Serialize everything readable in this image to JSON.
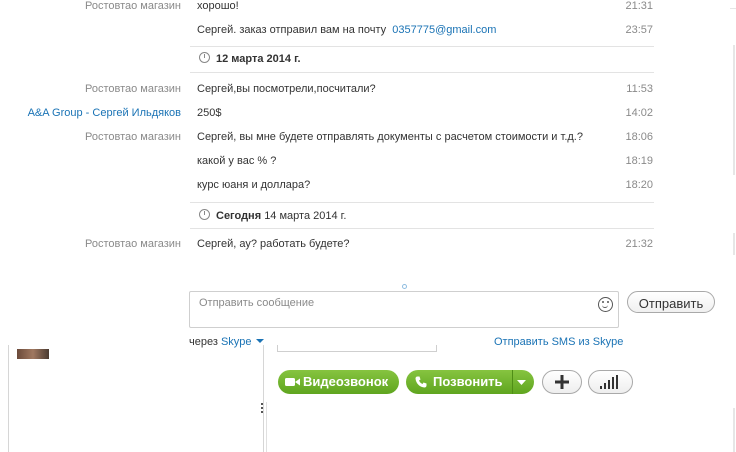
{
  "chat": {
    "entries": [
      {
        "sender": "Ростовтао магазин",
        "text": "хорошо!",
        "time": "21:31"
      },
      {
        "sender": "",
        "text": "Сергей. заказ отправил вам на почту",
        "link": "0357775@gmail.com",
        "time": "23:57"
      },
      {
        "sender": "Ростовтао магазин",
        "text": "Сергей,вы посмотрели,посчитали?",
        "time": "11:53"
      },
      {
        "sender": "A&A Group -  Сергей Ильдяков",
        "text": "250$",
        "time": "14:02"
      },
      {
        "sender": "Ростовтао магазин",
        "text": "Сергей, вы мне будете отправлять документы с расчетом стоимости и т.д.?",
        "time": "18:06"
      },
      {
        "sender": "",
        "text": "какой у вас % ?",
        "time": "18:19"
      },
      {
        "sender": "",
        "text": "курс юаня и доллара?",
        "time": "18:20"
      },
      {
        "sender": "Ростовтао магазин",
        "text": "Сергей, ау? работать будете?",
        "time": "21:32"
      }
    ],
    "date_separators": [
      {
        "bold": "12 марта 2014 г.",
        "rest": ""
      },
      {
        "bold": "Сегодня",
        "rest": "14 марта 2014 г."
      }
    ]
  },
  "composer": {
    "placeholder": "Отправить сообщение",
    "send_label": "Отправить",
    "via_label": "через",
    "via_service": "Skype",
    "sms_link": "Отправить SMS из Skype"
  },
  "call_bar": {
    "video_call_label": "Видеозвонок",
    "call_label": "Позвонить"
  },
  "colors": {
    "accent_blue": "#1a73b5",
    "call_green": "#6fb52c"
  }
}
